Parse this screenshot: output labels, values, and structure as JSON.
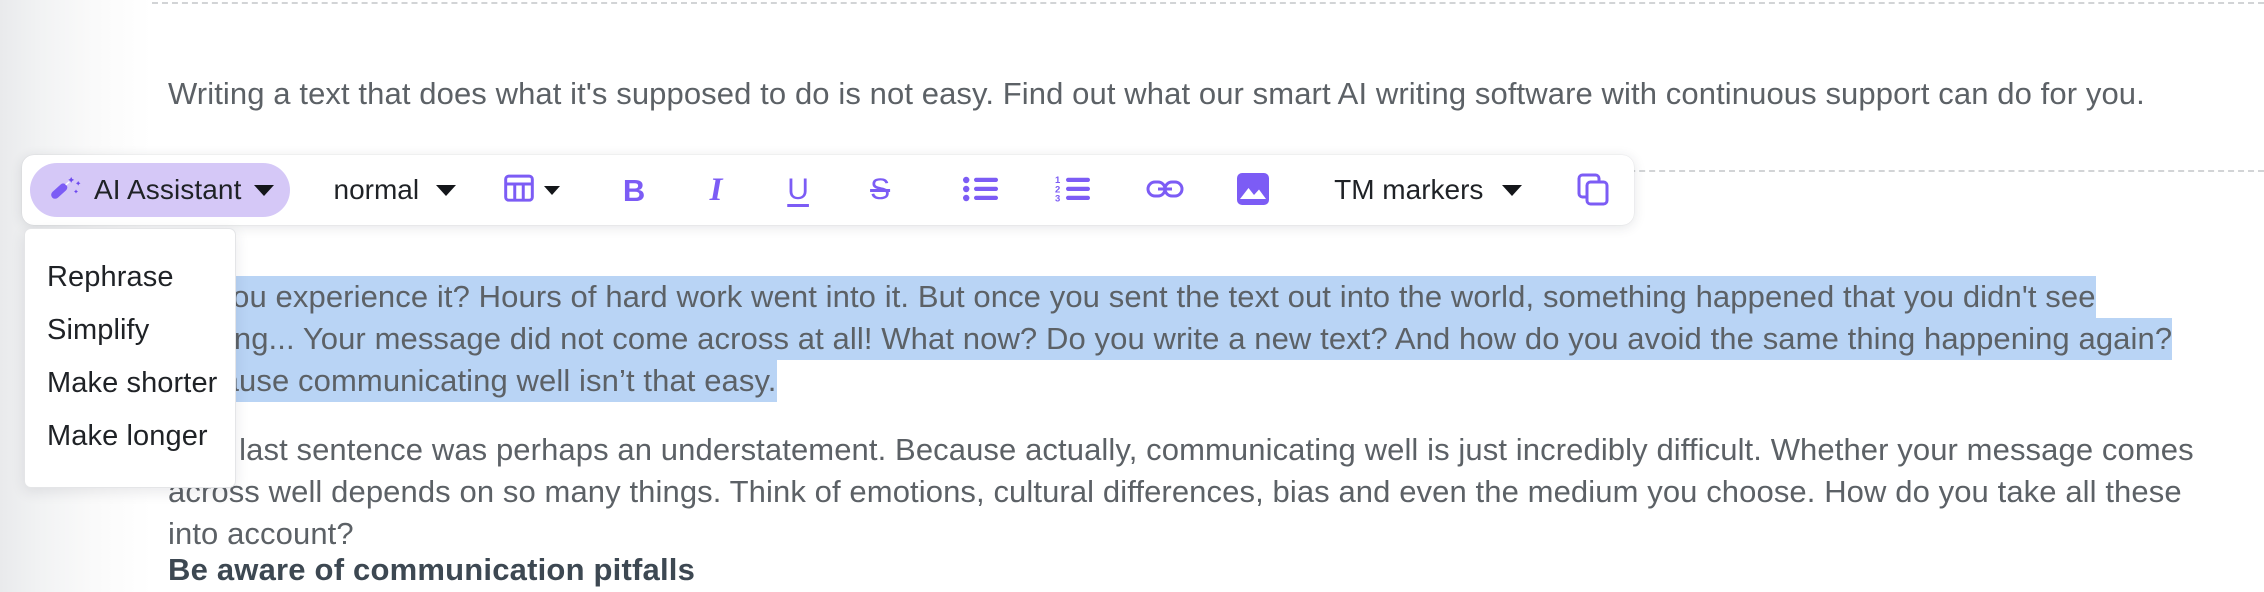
{
  "document": {
    "intro_paragraph": "Writing a text that does what it's supposed to do is not easy. Find out what our smart AI writing software with continuous support can do for you.",
    "body_paragraph_1_prefix": "",
    "body_paragraph_1_selected": "Do you experience it? Hours of hard work went into it. But once you sent the text out into the world, something happened that you didn't see coming... Your message did not come across at all! What now? Do you write a new text? And how do you avoid the same thing happening again? Because communicating well isn’t that easy.",
    "body_paragraph_2": "That last sentence was perhaps an understatement. Because actually, communicating well is just incredibly difficult. Whether your message comes across well depends on so many things. Think of emotions, cultural differences, bias and even the medium you choose. How do you take all these into account?",
    "heading": "Be aware of communication pitfalls"
  },
  "toolbar": {
    "ai_assistant_label": "AI Assistant",
    "ai_assistant_icon": "magic-wand-icon",
    "style_value": "normal",
    "table_icon": "table-icon",
    "bold_label": "B",
    "italic_label": "I",
    "underline_label": "U",
    "strikethrough_label": "S",
    "bullet_list_icon": "bulleted-list-icon",
    "numbered_list_icon": "numbered-list-icon",
    "link_icon": "link-icon",
    "image_icon": "image-icon",
    "tm_markers_label": "TM markers",
    "copy_icon": "copy-icon"
  },
  "ai_menu": {
    "items": [
      {
        "label": "Rephrase"
      },
      {
        "label": "Simplify"
      },
      {
        "label": "Make shorter"
      },
      {
        "label": "Make longer"
      }
    ]
  },
  "colors": {
    "accent_purple": "#7c5cf5",
    "pill_lavender": "#d5c8f7",
    "selection_blue": "#b9d4f5",
    "body_text": "#5c6166",
    "heading_text": "#3d4852"
  }
}
